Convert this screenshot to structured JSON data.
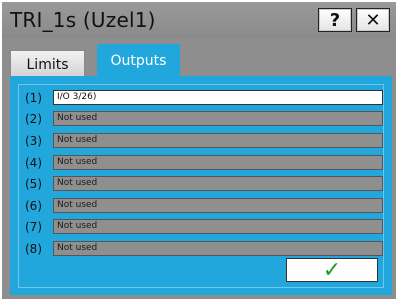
{
  "window": {
    "title": "TRI_1s (Uzel1)",
    "help_label": "?",
    "close_label": "✕"
  },
  "tabs": [
    {
      "label": "Limits",
      "selected": false
    },
    {
      "label": "Outputs",
      "selected": true
    }
  ],
  "outputs": [
    {
      "num": "(1)",
      "value": "I/O 3/26)"
    },
    {
      "num": "(2)",
      "value": "Not used"
    },
    {
      "num": "(3)",
      "value": "Not used"
    },
    {
      "num": "(4)",
      "value": "Not used"
    },
    {
      "num": "(5)",
      "value": "Not used"
    },
    {
      "num": "(6)",
      "value": "Not used"
    },
    {
      "num": "(7)",
      "value": "Not used"
    },
    {
      "num": "(8)",
      "value": "Not used"
    }
  ],
  "ok_button": {
    "label": "✓",
    "icon": "checkmark-icon"
  },
  "colors": {
    "accent": "#22a7dd",
    "frame": "#8e8e8e",
    "field_disabled": "#8f8f8f",
    "ok_check": "#1f9f2a"
  }
}
